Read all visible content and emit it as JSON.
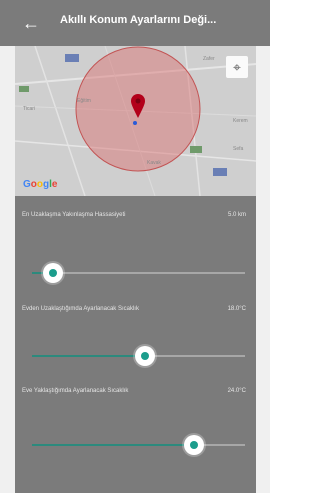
{
  "header": {
    "back_icon": "arrow-left-icon",
    "title": "Akıllı Konum Ayarlarını Deği..."
  },
  "map": {
    "labels": {
      "north": "Zafer",
      "west": "Ticari",
      "center_top": "Eğitim",
      "right": "Kerem",
      "right_bottom": "Sefa",
      "south": "Kavak"
    },
    "brand": "Google",
    "location_button_icon": "my-location-icon",
    "marker_icon": "map-pin-icon",
    "colors": {
      "radius_fill": "#d96a6a",
      "marker": "#b3001a"
    }
  },
  "settings": {
    "rows": [
      {
        "label": "En Uzaklaşma Yakınlaşma Hassasiyeti",
        "value": "5.0 km",
        "slider_fraction": 0.1
      },
      {
        "label": "Evden Uzaklaştığımda Ayarlanacak Sıcaklık",
        "value": "18.0°C",
        "slider_fraction": 0.53
      },
      {
        "label": "Eve Yaklaştığımda Ayarlanacak Sıcaklık",
        "value": "24.0°C",
        "slider_fraction": 0.76
      }
    ],
    "colors": {
      "track_fill": "#2c8a7d",
      "thumb_dot": "#1b9d8c"
    }
  }
}
